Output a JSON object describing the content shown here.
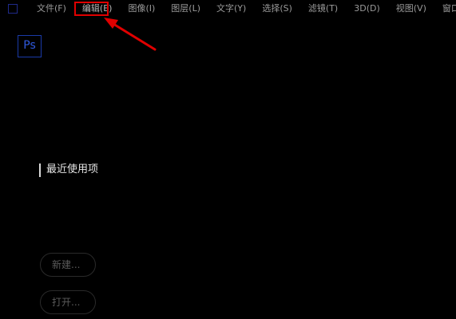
{
  "menubar": {
    "items": [
      {
        "label": "文件(F)"
      },
      {
        "label": "编辑(E)"
      },
      {
        "label": "图像(I)"
      },
      {
        "label": "图层(L)"
      },
      {
        "label": "文字(Y)"
      },
      {
        "label": "选择(S)"
      },
      {
        "label": "滤镜(T)"
      },
      {
        "label": "3D(D)"
      },
      {
        "label": "视图(V)"
      },
      {
        "label": "窗口(W)"
      }
    ],
    "highlighted_item": "编辑(E)"
  },
  "logo": {
    "text": "Ps"
  },
  "home": {
    "recent_label": "最近使用项",
    "new_button": "新建...",
    "open_button": "打开..."
  },
  "colors": {
    "background": "#000000",
    "annotation": "#e00000",
    "logo": "#2f5ae0"
  }
}
